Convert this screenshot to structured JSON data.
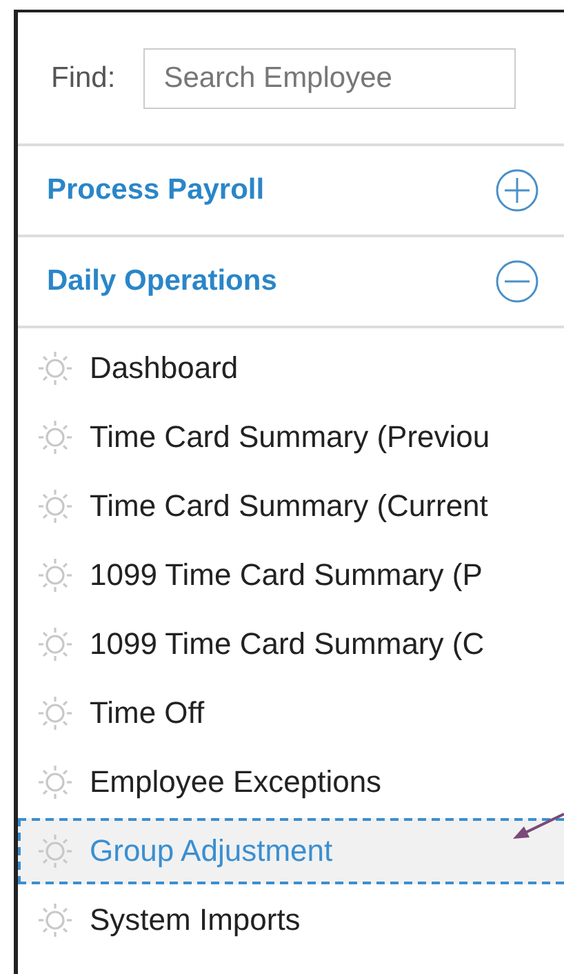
{
  "find": {
    "label": "Find:",
    "placeholder": "Search Employee"
  },
  "sections": [
    {
      "label": "Process Payroll",
      "expanded": false
    },
    {
      "label": "Daily Operations",
      "expanded": true,
      "items": [
        {
          "label": "Dashboard",
          "selected": false
        },
        {
          "label": "Time Card Summary (Previou",
          "selected": false
        },
        {
          "label": "Time Card Summary (Current",
          "selected": false
        },
        {
          "label": "1099 Time Card Summary (P",
          "selected": false
        },
        {
          "label": "1099 Time Card Summary (C",
          "selected": false
        },
        {
          "label": "Time Off",
          "selected": false
        },
        {
          "label": "Employee Exceptions",
          "selected": false
        },
        {
          "label": "Group Adjustment",
          "selected": true
        },
        {
          "label": "System Imports",
          "selected": false
        }
      ]
    }
  ]
}
